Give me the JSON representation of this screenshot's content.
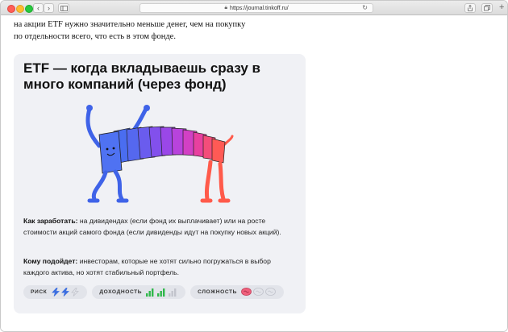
{
  "browser": {
    "url": "https://journal.tinkoff.ru/",
    "back": "‹",
    "forward": "›",
    "reload": "↻"
  },
  "intro": {
    "line1": "на акции ETF нужно значительно меньше денег, чем на покупку",
    "line2": "по отдельности всего, что есть в этом фонде."
  },
  "card": {
    "title": "ETF — когда вкладываешь сразу в много компаний (через фонд)",
    "earn_label": "Как заработать:",
    "earn_text": " на дивидендах (если фонд их выплачивает) или на росте стоимости акций самого фонда (если дивиденды идут на покупку новых акций).",
    "suits_label": "Кому подойдет:",
    "suits_text": " инвесторам, которые не хотят сильно погружаться в выбор каждого актива, но хотят стабильный портфель.",
    "metrics": [
      {
        "label": "РИСК",
        "icon": "lightning-icon",
        "level": 2,
        "max": 3,
        "color": "#3d6fe0"
      },
      {
        "label": "ДОХОДНОСТЬ",
        "icon": "bar-chart-icon",
        "level": 2,
        "max": 3,
        "color": "#2fb84a"
      },
      {
        "label": "СЛОЖНОСТЬ",
        "icon": "brain-icon",
        "level": 1,
        "max": 3,
        "color": "#f0607c"
      }
    ]
  }
}
